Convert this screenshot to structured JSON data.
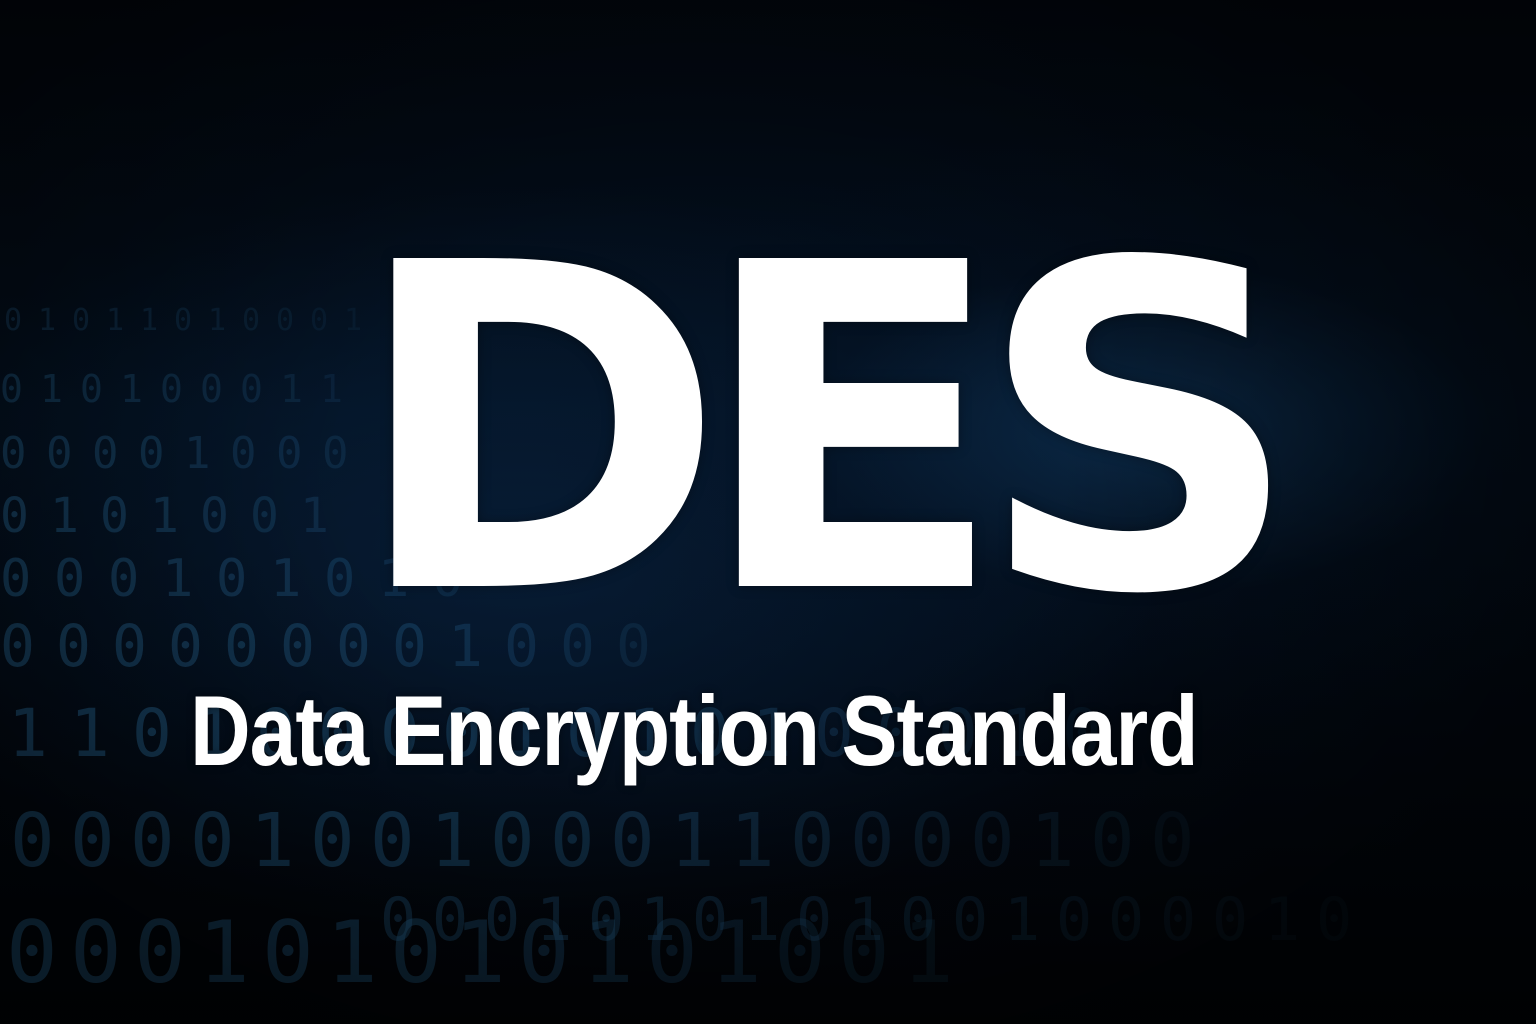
{
  "heading": {
    "title": "DES",
    "subtitle": "Data Encryption Standard"
  },
  "background": {
    "binary_rows": [
      "01011010001",
      "010100011",
      "00001000",
      "0101001",
      "000101010",
      "000000001000",
      "110100001010100010",
      "00001001000110000100",
      "0001010101001000010",
      "000101010101001"
    ],
    "colors": {
      "base": "#010409",
      "glow": "#123e68",
      "digits": "#2a6e9e",
      "text": "#ffffff"
    }
  }
}
